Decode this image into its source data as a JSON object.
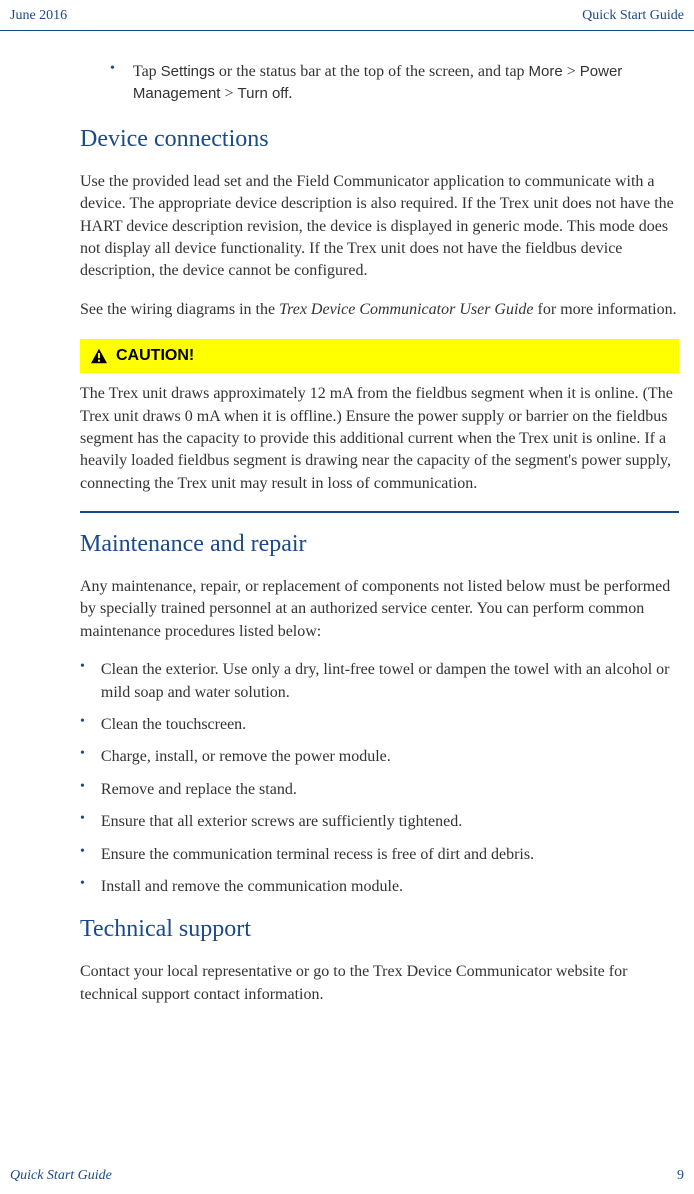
{
  "header": {
    "date": "June 2016",
    "title": "Quick Start Guide"
  },
  "top_bullet": {
    "prefix": "Tap ",
    "settings": "Settings",
    "mid1": " or the status bar at the top of the screen, and tap ",
    "more": "More",
    "arrow1": " > ",
    "power": "Power Management",
    "arrow2": " > ",
    "turnoff": "Turn off",
    "period": "."
  },
  "sections": {
    "device_connections": {
      "heading": "Device connections",
      "para1": "Use the provided lead set and the Field Communicator application to communicate with a device. The appropriate device description is also required. If the Trex unit does not have the HART device description revision, the device is displayed in generic mode. This mode does not display all device functionality. If the Trex unit does not have the fieldbus device description, the device cannot be configured.",
      "para2_prefix": "See the wiring diagrams in the ",
      "para2_italic": "Trex Device Communicator User Guide",
      "para2_suffix": " for more information."
    },
    "caution": {
      "label": "CAUTION!",
      "text": "The Trex unit draws approximately 12 mA from the fieldbus segment when it is online. (The Trex unit draws 0 mA when it is offline.) Ensure the power supply or barrier on the fieldbus segment has the capacity to provide this additional current when the Trex unit is online. If a heavily loaded fieldbus segment is drawing near the capacity of the segment's power supply, connecting the Trex unit may result in loss of communication."
    },
    "maintenance": {
      "heading": "Maintenance and repair",
      "para": "Any maintenance, repair, or replacement of components not listed below must be performed by specially trained personnel at an authorized service center. You can perform common maintenance procedures listed below:",
      "bullets": [
        "Clean the exterior. Use only a dry, lint-free towel or dampen the towel with an alcohol or mild soap and water solution.",
        "Clean the touchscreen.",
        "Charge, install, or remove the power module.",
        "Remove and replace the stand.",
        "Ensure that all exterior screws are sufficiently tightened.",
        "Ensure the communication terminal recess is free of dirt and debris.",
        "Install and remove the communication module."
      ]
    },
    "technical_support": {
      "heading": "Technical support",
      "para": "Contact your local representative or go to the Trex Device Communicator website for technical support contact information."
    }
  },
  "footer": {
    "title": "Quick Start Guide",
    "page": "9"
  }
}
